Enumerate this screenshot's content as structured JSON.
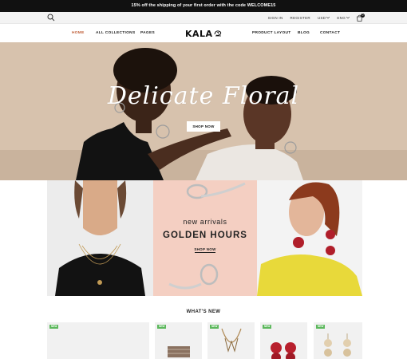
{
  "announcement": "15% off the shipping of your first order with the code WELCOME15",
  "utility": {
    "sign_in": "SIGN IN",
    "register": "REGISTER",
    "currency": "USD",
    "language": "ENG",
    "cart_count": "0"
  },
  "nav": {
    "items": [
      "HOME",
      "ALL COLLECTIONS",
      "PAGES",
      "PRODUCT LAYOUT",
      "BLOG",
      "CONTACT"
    ],
    "logo": "KALA"
  },
  "hero": {
    "title": "Delicate Floral",
    "button": "SHOP NOW"
  },
  "promo": {
    "eyebrow": "new arrivals",
    "headline": "GOLDEN HOURS",
    "link": "SHOP NOW"
  },
  "section": {
    "title": "WHAT'S NEW"
  },
  "products": [
    {
      "badge": "NEW"
    },
    {
      "badge": "NEW"
    },
    {
      "badge": "NEW"
    },
    {
      "badge": "NEW"
    },
    {
      "badge": "NEW"
    }
  ],
  "colors": {
    "accent": "#c0603a",
    "hero_bg": "#d7c2ad",
    "promo_pink": "#f4cfc2",
    "badge_green": "#5cb85c"
  }
}
